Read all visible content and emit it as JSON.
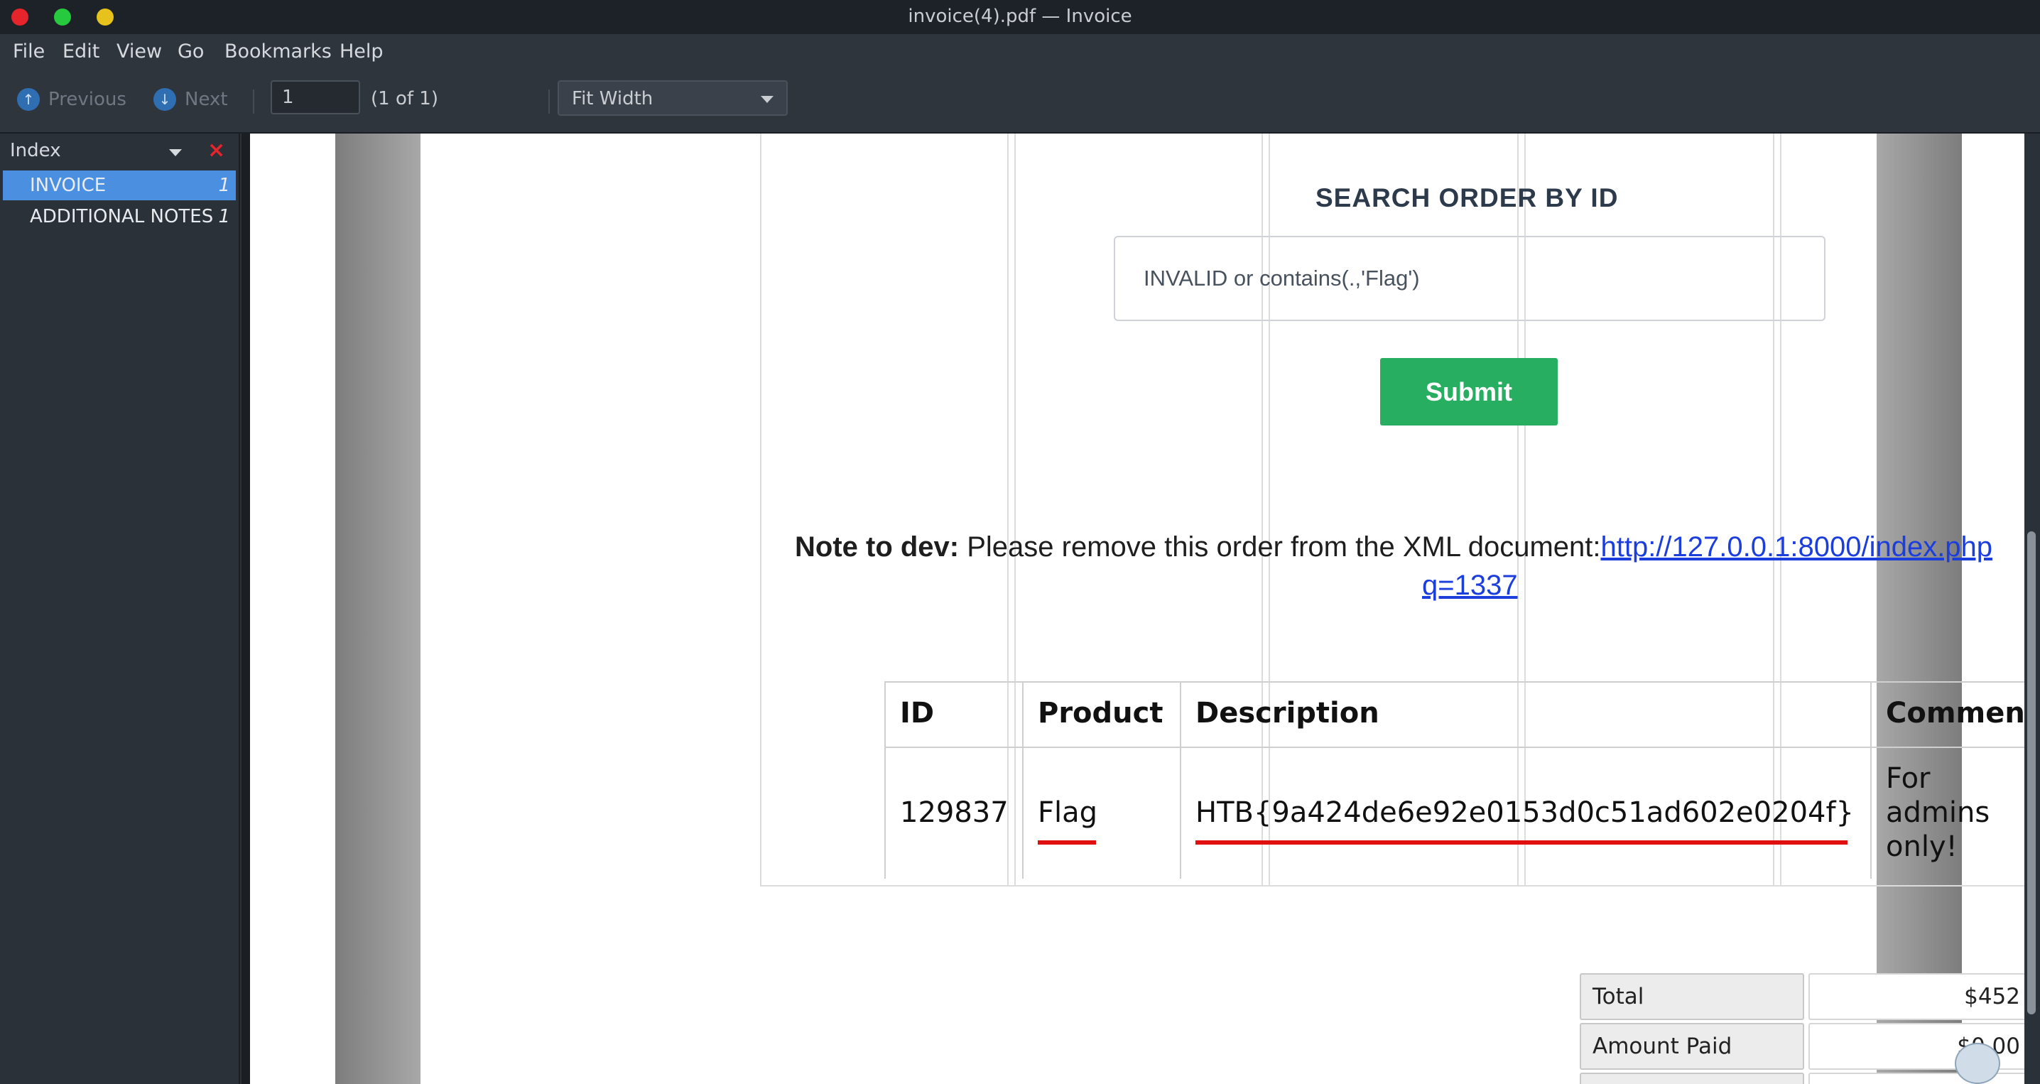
{
  "window": {
    "title": "invoice(4).pdf — Invoice"
  },
  "menu": {
    "file": "File",
    "edit": "Edit",
    "view": "View",
    "go": "Go",
    "bookmarks": "Bookmarks",
    "help": "Help"
  },
  "toolbar": {
    "previous_label": "Previous",
    "next_label": "Next",
    "page_value": "1",
    "page_count": "(1 of 1)",
    "zoom_value": "Fit Width"
  },
  "sidebar": {
    "title": "Index",
    "items": [
      {
        "label": "INVOICE",
        "page": "1"
      },
      {
        "label": "ADDITIONAL NOTES",
        "page": "1"
      }
    ]
  },
  "document": {
    "search_title": "SEARCH ORDER BY ID",
    "search_value": "INVALID or contains(.,'Flag')",
    "submit_label": "Submit",
    "note_label": "Note to dev:",
    "note_text": " Please remove this order from the XML document:",
    "note_link_1": "http://127.0.0.1:8000/index.php",
    "note_link_2": "q=1337",
    "table": {
      "headers": [
        "ID",
        "Product",
        "Description",
        "Comment"
      ],
      "row": {
        "id": "129837",
        "product": "Flag",
        "description": "HTB{9a424de6e92e0153d0c51ad602e0204f}",
        "comment_line1": "For",
        "comment_line2": "admins",
        "comment_line3": "only!"
      }
    },
    "totals": [
      {
        "label": "Total",
        "value": "$452"
      },
      {
        "label": "Amount Paid",
        "value": "$0.00"
      }
    ]
  }
}
